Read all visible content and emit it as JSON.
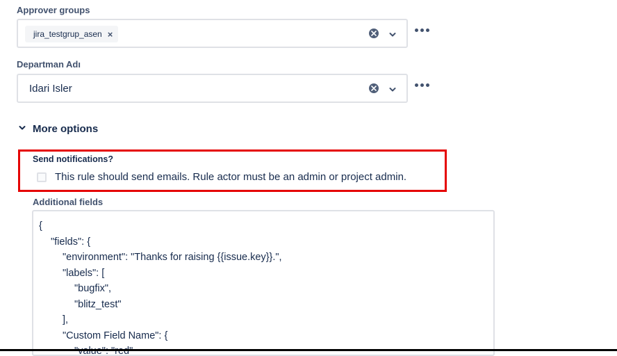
{
  "approver_groups": {
    "label": "Approver groups",
    "chip": "jira_testgrup_asen",
    "chip_remove": "×"
  },
  "departman": {
    "label": "Departman Adı",
    "value": "Idari Isler"
  },
  "more_options": {
    "label": "More options"
  },
  "notifications": {
    "label": "Send notifications?",
    "checkbox_label": "This rule should send emails. Rule actor must be an admin or project admin.",
    "checked": false
  },
  "additional_fields": {
    "label": "Additional fields",
    "lines": [
      "{",
      "\"fields\": {",
      "\"environment\": \"Thanks for raising {{issue.key}}.\",",
      "\"labels\": [",
      "\"bugfix\",",
      "\"blitz_test\"",
      "],",
      "\"Custom Field Name\": {",
      "\"value\": \"red\""
    ]
  },
  "colors": {
    "highlight": "#e50000",
    "border": "#dfe1e6",
    "text": "#172b4d",
    "label": "#42526e"
  },
  "icons": {
    "clear": "clear-icon",
    "chevron": "chevron-down-icon",
    "more": "more-icon"
  }
}
